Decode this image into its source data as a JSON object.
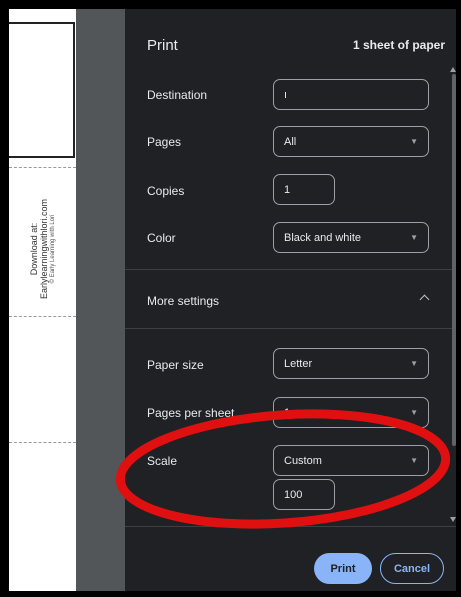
{
  "preview": {
    "credit_line1": "Download at:",
    "credit_line2": "Earlylearningwithlori.com",
    "credit_line3": "© Early Learning with Lori"
  },
  "header": {
    "title": "Print",
    "sheet_count": "1 sheet of paper"
  },
  "settings": {
    "destination": {
      "label": "Destination",
      "value": "ı"
    },
    "pages": {
      "label": "Pages",
      "value": "All"
    },
    "copies": {
      "label": "Copies",
      "value": "1"
    },
    "color": {
      "label": "Color",
      "value": "Black and white"
    },
    "more_settings": {
      "label": "More settings"
    },
    "paper_size": {
      "label": "Paper size",
      "value": "Letter"
    },
    "pages_per_sheet": {
      "label": "Pages per sheet",
      "value": "1"
    },
    "scale": {
      "label": "Scale",
      "value": "Custom",
      "custom_value": "100"
    }
  },
  "footer": {
    "print_label": "Print",
    "cancel_label": "Cancel"
  },
  "colors": {
    "panel_bg": "#202124",
    "gutter_bg": "#525659",
    "accent": "#8ab4f8",
    "annotation": "#e01010"
  },
  "icons": {
    "dropdown": "chevron-down-icon",
    "collapse": "chevron-up-icon"
  }
}
